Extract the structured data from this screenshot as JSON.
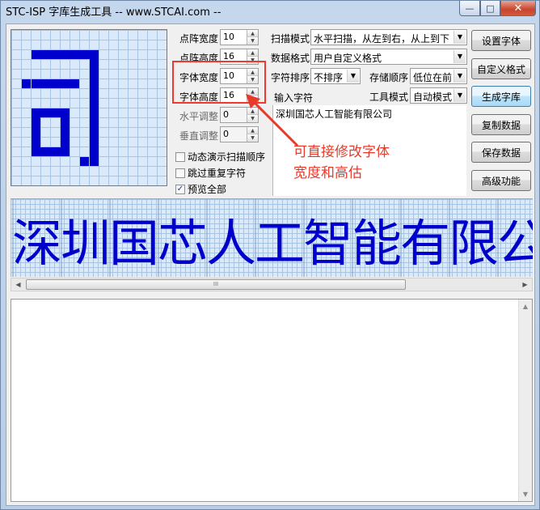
{
  "window": {
    "title": "STC-ISP 字库生成工具 -- www.STCAI.com --",
    "min_glyph": "—",
    "max_glyph": "□",
    "close_glyph": "✕"
  },
  "fields": {
    "dot_width": {
      "label": "点阵宽度",
      "value": "10"
    },
    "dot_height": {
      "label": "点阵高度",
      "value": "16"
    },
    "font_width": {
      "label": "字体宽度",
      "value": "10"
    },
    "font_height": {
      "label": "字体高度",
      "value": "16"
    },
    "h_adjust": {
      "label": "水平调整",
      "value": "0"
    },
    "v_adjust": {
      "label": "垂直调整",
      "value": "0"
    }
  },
  "options": {
    "scan_mode": {
      "label": "扫描模式",
      "value": "水平扫描，从左到右，从上到下"
    },
    "data_format": {
      "label": "数据格式",
      "value": "用户自定义格式"
    },
    "char_sort": {
      "label": "字符排序",
      "value": "不排序"
    },
    "storage_order": {
      "label": "存储顺序",
      "value": "低位在前"
    },
    "tool_mode": {
      "label": "工具模式",
      "value": "自动模式"
    },
    "input_label": "输入字符",
    "input_value": "深圳国芯人工智能有限公司"
  },
  "checkboxes": [
    {
      "label": "动态演示扫描顺序",
      "checked": false
    },
    {
      "label": "跳过重复字符",
      "checked": false
    },
    {
      "label": "预览全部",
      "checked": true
    }
  ],
  "buttons": {
    "set_font": "设置字体",
    "custom_format": "自定义格式",
    "generate": "生成字库",
    "copy_data": "复制数据",
    "save_data": "保存数据",
    "advanced": "高级功能"
  },
  "annotation": {
    "line1": "可直接修改字体",
    "line2": "宽度和高估",
    "color": "#e83a2a"
  },
  "preview_char": "司",
  "strip_chars": [
    "深",
    "圳",
    "国",
    "芯",
    "人",
    "工",
    "智",
    "能",
    "有",
    "限",
    "公"
  ],
  "glyph_color": "#0000cc",
  "scroll_thumb_grip": "III"
}
